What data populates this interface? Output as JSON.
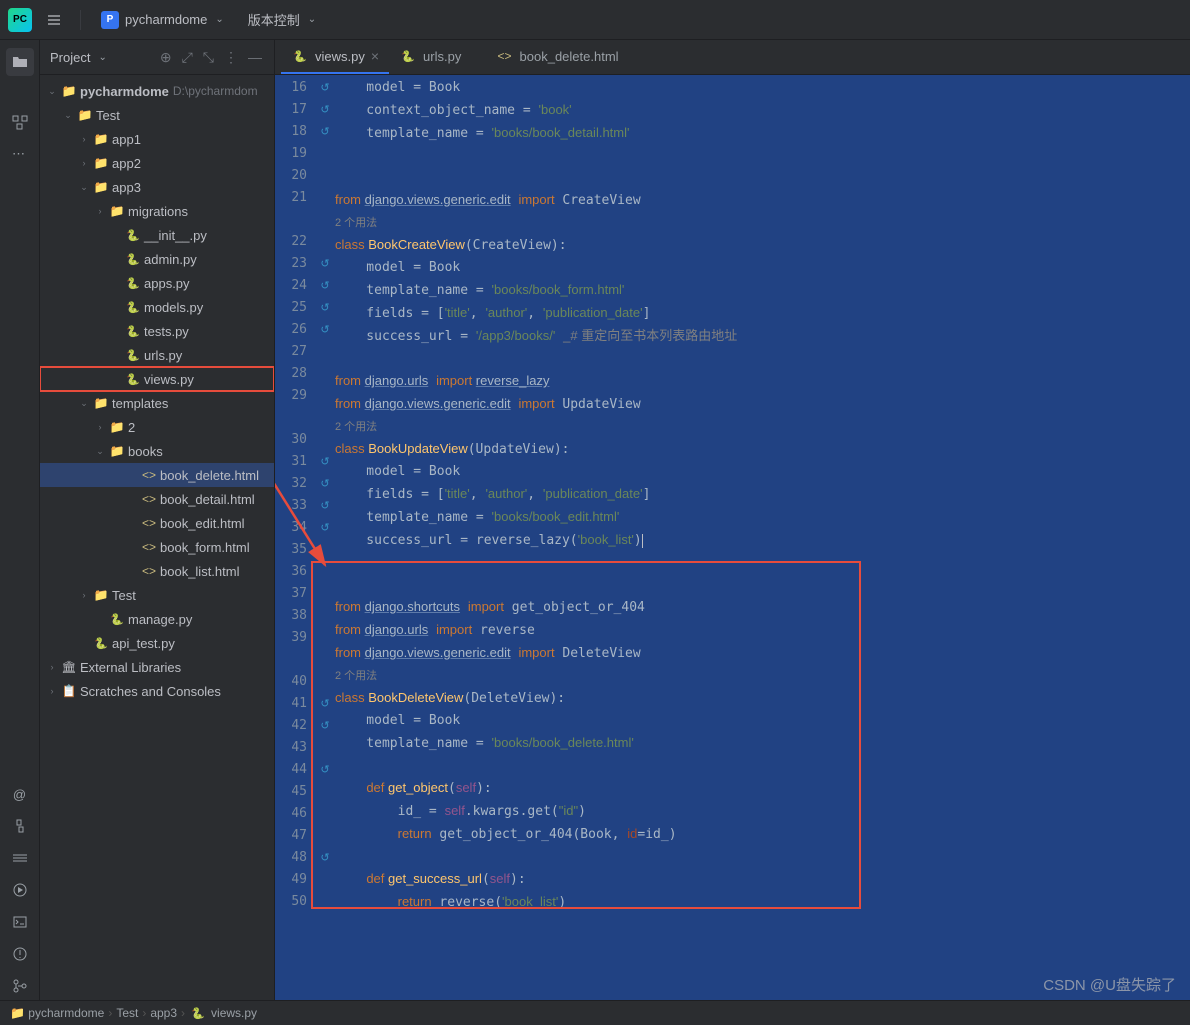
{
  "titlebar": {
    "ide_badge": "PC",
    "project_badge": "P",
    "project_name": "pycharmdome",
    "vcs_label": "版本控制"
  },
  "project_panel": {
    "title": "Project"
  },
  "tree": {
    "root": {
      "name": "pycharmdome",
      "path": "D:\\pycharmdom"
    },
    "test_folder": "Test",
    "app1": "app1",
    "app2": "app2",
    "app3": "app3",
    "migrations": "migrations",
    "init_py": "__init__.py",
    "admin_py": "admin.py",
    "apps_py": "apps.py",
    "models_py": "models.py",
    "tests_py": "tests.py",
    "urls_py": "urls.py",
    "views_py": "views.py",
    "templates": "templates",
    "folder_2": "2",
    "books": "books",
    "book_delete": "book_delete.html",
    "book_detail": "book_detail.html",
    "book_edit": "book_edit.html",
    "book_form": "book_form.html",
    "book_list": "book_list.html",
    "test2": "Test",
    "manage_py": "manage.py",
    "api_test_py": "api_test.py",
    "ext_lib": "External Libraries",
    "scratches": "Scratches and Consoles"
  },
  "tabs": {
    "views": "views.py",
    "urls": "urls.py",
    "book_delete": "book_delete.html"
  },
  "code": {
    "line_start": 16,
    "line_end": 50,
    "usage_hint": "2 个用法",
    "comment_redirect": "# 重定向至书本列表路由地址",
    "lines": [
      "16",
      "17",
      "18",
      "19",
      "20",
      "21",
      "",
      "22",
      "23",
      "24",
      "25",
      "26",
      "27",
      "28",
      "29",
      "",
      "30",
      "31",
      "32",
      "33",
      "34",
      "35",
      "36",
      "37",
      "38",
      "39",
      "",
      "40",
      "41",
      "42",
      "43",
      "44",
      "45",
      "46",
      "47",
      "48",
      "49",
      "50"
    ]
  },
  "statusbar": {
    "root": "pycharmdome",
    "folder": "Test",
    "app": "app3",
    "file": "views.py"
  },
  "watermark": "CSDN @U盘失踪了"
}
